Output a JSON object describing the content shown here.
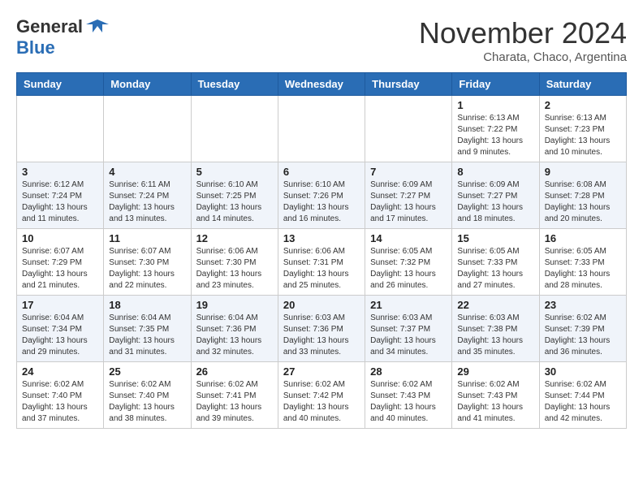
{
  "header": {
    "logo_line1": "General",
    "logo_line2": "Blue",
    "month_title": "November 2024",
    "location": "Charata, Chaco, Argentina"
  },
  "weekdays": [
    "Sunday",
    "Monday",
    "Tuesday",
    "Wednesday",
    "Thursday",
    "Friday",
    "Saturday"
  ],
  "weeks": [
    [
      {
        "day": "",
        "info": ""
      },
      {
        "day": "",
        "info": ""
      },
      {
        "day": "",
        "info": ""
      },
      {
        "day": "",
        "info": ""
      },
      {
        "day": "",
        "info": ""
      },
      {
        "day": "1",
        "info": "Sunrise: 6:13 AM\nSunset: 7:22 PM\nDaylight: 13 hours\nand 9 minutes."
      },
      {
        "day": "2",
        "info": "Sunrise: 6:13 AM\nSunset: 7:23 PM\nDaylight: 13 hours\nand 10 minutes."
      }
    ],
    [
      {
        "day": "3",
        "info": "Sunrise: 6:12 AM\nSunset: 7:24 PM\nDaylight: 13 hours\nand 11 minutes."
      },
      {
        "day": "4",
        "info": "Sunrise: 6:11 AM\nSunset: 7:24 PM\nDaylight: 13 hours\nand 13 minutes."
      },
      {
        "day": "5",
        "info": "Sunrise: 6:10 AM\nSunset: 7:25 PM\nDaylight: 13 hours\nand 14 minutes."
      },
      {
        "day": "6",
        "info": "Sunrise: 6:10 AM\nSunset: 7:26 PM\nDaylight: 13 hours\nand 16 minutes."
      },
      {
        "day": "7",
        "info": "Sunrise: 6:09 AM\nSunset: 7:27 PM\nDaylight: 13 hours\nand 17 minutes."
      },
      {
        "day": "8",
        "info": "Sunrise: 6:09 AM\nSunset: 7:27 PM\nDaylight: 13 hours\nand 18 minutes."
      },
      {
        "day": "9",
        "info": "Sunrise: 6:08 AM\nSunset: 7:28 PM\nDaylight: 13 hours\nand 20 minutes."
      }
    ],
    [
      {
        "day": "10",
        "info": "Sunrise: 6:07 AM\nSunset: 7:29 PM\nDaylight: 13 hours\nand 21 minutes."
      },
      {
        "day": "11",
        "info": "Sunrise: 6:07 AM\nSunset: 7:30 PM\nDaylight: 13 hours\nand 22 minutes."
      },
      {
        "day": "12",
        "info": "Sunrise: 6:06 AM\nSunset: 7:30 PM\nDaylight: 13 hours\nand 23 minutes."
      },
      {
        "day": "13",
        "info": "Sunrise: 6:06 AM\nSunset: 7:31 PM\nDaylight: 13 hours\nand 25 minutes."
      },
      {
        "day": "14",
        "info": "Sunrise: 6:05 AM\nSunset: 7:32 PM\nDaylight: 13 hours\nand 26 minutes."
      },
      {
        "day": "15",
        "info": "Sunrise: 6:05 AM\nSunset: 7:33 PM\nDaylight: 13 hours\nand 27 minutes."
      },
      {
        "day": "16",
        "info": "Sunrise: 6:05 AM\nSunset: 7:33 PM\nDaylight: 13 hours\nand 28 minutes."
      }
    ],
    [
      {
        "day": "17",
        "info": "Sunrise: 6:04 AM\nSunset: 7:34 PM\nDaylight: 13 hours\nand 29 minutes."
      },
      {
        "day": "18",
        "info": "Sunrise: 6:04 AM\nSunset: 7:35 PM\nDaylight: 13 hours\nand 31 minutes."
      },
      {
        "day": "19",
        "info": "Sunrise: 6:04 AM\nSunset: 7:36 PM\nDaylight: 13 hours\nand 32 minutes."
      },
      {
        "day": "20",
        "info": "Sunrise: 6:03 AM\nSunset: 7:36 PM\nDaylight: 13 hours\nand 33 minutes."
      },
      {
        "day": "21",
        "info": "Sunrise: 6:03 AM\nSunset: 7:37 PM\nDaylight: 13 hours\nand 34 minutes."
      },
      {
        "day": "22",
        "info": "Sunrise: 6:03 AM\nSunset: 7:38 PM\nDaylight: 13 hours\nand 35 minutes."
      },
      {
        "day": "23",
        "info": "Sunrise: 6:02 AM\nSunset: 7:39 PM\nDaylight: 13 hours\nand 36 minutes."
      }
    ],
    [
      {
        "day": "24",
        "info": "Sunrise: 6:02 AM\nSunset: 7:40 PM\nDaylight: 13 hours\nand 37 minutes."
      },
      {
        "day": "25",
        "info": "Sunrise: 6:02 AM\nSunset: 7:40 PM\nDaylight: 13 hours\nand 38 minutes."
      },
      {
        "day": "26",
        "info": "Sunrise: 6:02 AM\nSunset: 7:41 PM\nDaylight: 13 hours\nand 39 minutes."
      },
      {
        "day": "27",
        "info": "Sunrise: 6:02 AM\nSunset: 7:42 PM\nDaylight: 13 hours\nand 40 minutes."
      },
      {
        "day": "28",
        "info": "Sunrise: 6:02 AM\nSunset: 7:43 PM\nDaylight: 13 hours\nand 40 minutes."
      },
      {
        "day": "29",
        "info": "Sunrise: 6:02 AM\nSunset: 7:43 PM\nDaylight: 13 hours\nand 41 minutes."
      },
      {
        "day": "30",
        "info": "Sunrise: 6:02 AM\nSunset: 7:44 PM\nDaylight: 13 hours\nand 42 minutes."
      }
    ]
  ]
}
